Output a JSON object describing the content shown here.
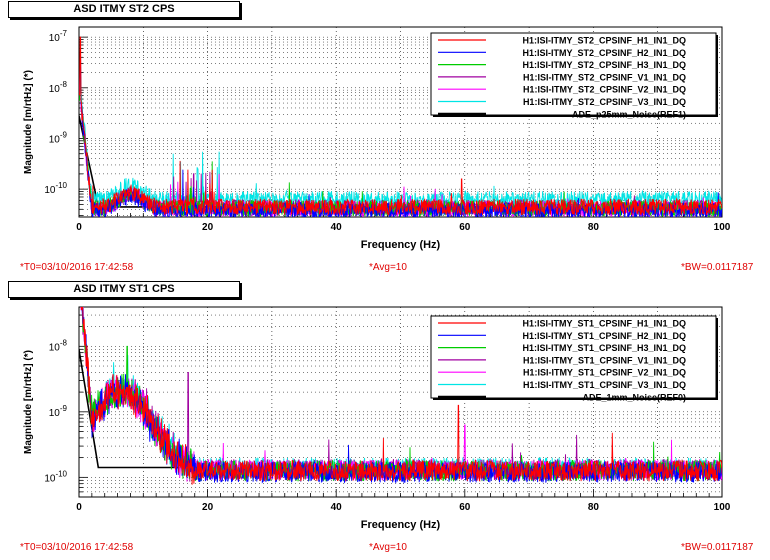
{
  "chart_data": [
    {
      "type": "line",
      "title": "ASD ITMY ST2 CPS",
      "xlabel": "Frequency (Hz)",
      "ylabel": "Magnitude [m/rtHz] (*)",
      "xlim": [
        0,
        100
      ],
      "ylim_log10": [
        -10.55,
        -6.8
      ],
      "y_scale": "log",
      "x_ticks": [
        0,
        20,
        40,
        60,
        80,
        100
      ],
      "y_ticks": [
        {
          "exp": -7,
          "label_base": "10",
          "label_exp": "-7"
        },
        {
          "exp": -8,
          "label_base": "10",
          "label_exp": "-8"
        },
        {
          "exp": -9,
          "label_base": "10",
          "label_exp": "-9"
        },
        {
          "exp": -10,
          "label_base": "10",
          "label_exp": "-10"
        }
      ],
      "grid": true,
      "legend_position": "top-right",
      "series": [
        {
          "name": "H1:ISI-ITMY_ST2_CPSINF_H1_IN1_DQ",
          "color": "#ff0000",
          "floor_log10": -10.35,
          "peaks": [
            [
              0.2,
              -7.0
            ],
            [
              59.5,
              -9.8
            ]
          ]
        },
        {
          "name": "H1:ISI-ITMY_ST2_CPSINF_H2_IN1_DQ",
          "color": "#0000ff",
          "floor_log10": -10.42,
          "peaks": [
            [
              0.2,
              -7.4
            ]
          ]
        },
        {
          "name": "H1:ISI-ITMY_ST2_CPSINF_H3_IN1_DQ",
          "color": "#00cc00",
          "floor_log10": -10.38,
          "peaks": [
            [
              0.2,
              -7.6
            ]
          ]
        },
        {
          "name": "H1:ISI-ITMY_ST2_CPSINF_V1_IN1_DQ",
          "color": "#a000a0",
          "floor_log10": -10.37,
          "peaks": [
            [
              0.2,
              -7.8
            ]
          ]
        },
        {
          "name": "H1:ISI-ITMY_ST2_CPSINF_V2_IN1_DQ",
          "color": "#ff00ff",
          "floor_log10": -10.39,
          "peaks": [
            [
              0.2,
              -7.7
            ]
          ]
        },
        {
          "name": "H1:ISI-ITMY_ST2_CPSINF_V3_IN1_DQ",
          "color": "#00e5e5",
          "floor_log10": -10.2,
          "peaks": [
            [
              0.2,
              -8.0
            ],
            [
              18.5,
              -9.6
            ]
          ]
        },
        {
          "name": "ADE_p25mm_Noise(REF1)",
          "color": "#000000",
          "floor_log10": -10.35,
          "peaks": []
        }
      ]
    },
    {
      "type": "line",
      "title": "ASD ITMY ST1 CPS",
      "xlabel": "Frequency (Hz)",
      "ylabel": "Magnitude [m/rtHz] (*)",
      "xlim": [
        0,
        100
      ],
      "ylim_log10": [
        -10.3,
        -7.4
      ],
      "y_scale": "log",
      "x_ticks": [
        0,
        20,
        40,
        60,
        80,
        100
      ],
      "y_ticks": [
        {
          "exp": -8,
          "label_base": "10",
          "label_exp": "-8"
        },
        {
          "exp": -9,
          "label_base": "10",
          "label_exp": "-9"
        },
        {
          "exp": -10,
          "label_base": "10",
          "label_exp": "-10"
        }
      ],
      "grid": true,
      "legend_position": "top-right",
      "series": [
        {
          "name": "H1:ISI-ITMY_ST1_CPSINF_H1_IN1_DQ",
          "color": "#ff0000",
          "floor_log10": -9.9,
          "peaks": [
            [
              0.2,
              -7.6
            ],
            [
              7.5,
              -8.7
            ],
            [
              59,
              -8.9
            ]
          ]
        },
        {
          "name": "H1:ISI-ITMY_ST1_CPSINF_H2_IN1_DQ",
          "color": "#0000ff",
          "floor_log10": -9.92,
          "peaks": [
            [
              0.2,
              -7.5
            ],
            [
              7.5,
              -8.75
            ]
          ]
        },
        {
          "name": "H1:ISI-ITMY_ST1_CPSINF_H3_IN1_DQ",
          "color": "#00cc00",
          "floor_log10": -9.9,
          "peaks": [
            [
              0.2,
              -7.7
            ],
            [
              7.5,
              -8.0
            ]
          ]
        },
        {
          "name": "H1:ISI-ITMY_ST1_CPSINF_V1_IN1_DQ",
          "color": "#a000a0",
          "floor_log10": -9.88,
          "peaks": [
            [
              0.2,
              -7.8
            ],
            [
              17,
              -8.4
            ]
          ]
        },
        {
          "name": "H1:ISI-ITMY_ST1_CPSINF_V2_IN1_DQ",
          "color": "#ff00ff",
          "floor_log10": -9.89,
          "peaks": [
            [
              0.2,
              -7.8
            ],
            [
              60,
              -9.2
            ]
          ]
        },
        {
          "name": "H1:ISI-ITMY_ST1_CPSINF_V3_IN1_DQ",
          "color": "#00e5e5",
          "floor_log10": -9.86,
          "peaks": [
            [
              0.2,
              -7.9
            ]
          ]
        },
        {
          "name": "ADE_1mm_Noise(REF0)",
          "color": "#000000",
          "floor_log10": -9.85,
          "peaks": []
        }
      ]
    }
  ],
  "footer_top": {
    "t0": "*T0=03/10/2016 17:42:58",
    "avg": "*Avg=10",
    "bw": "*BW=0.0117187"
  },
  "footer_bot": {
    "t0": "*T0=03/10/2016 17:42:58",
    "avg": "*Avg=10",
    "bw": "*BW=0.0117187"
  }
}
